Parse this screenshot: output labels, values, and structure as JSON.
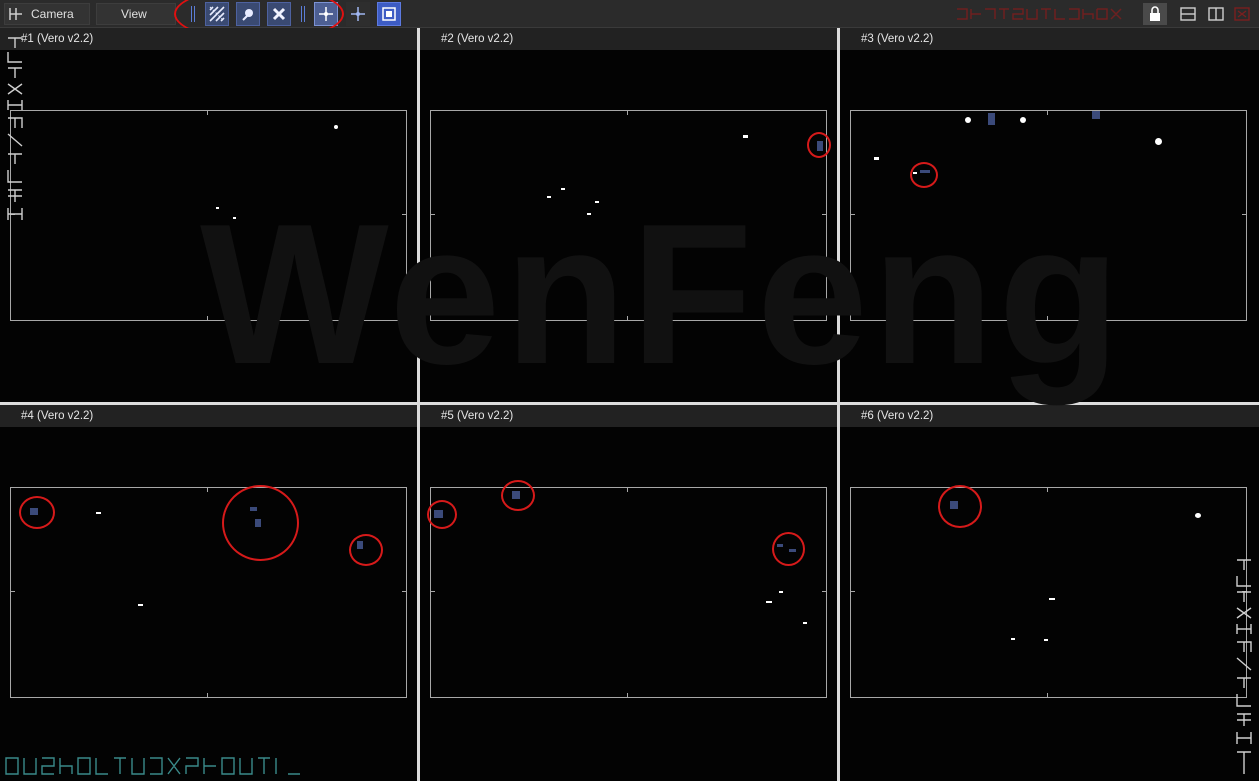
{
  "toolbar": {
    "camera_label": "Camera",
    "view_label": "View",
    "tools": [
      {
        "icon": "grid-pattern-icon"
      },
      {
        "icon": "marker-icon"
      },
      {
        "icon": "remove-markers-icon"
      },
      {
        "icon": "crosshair-add-icon"
      },
      {
        "icon": "crosshair-icon"
      },
      {
        "icon": "frame-icon"
      }
    ],
    "window_icons": [
      "lock-icon",
      "split-horizontal-icon",
      "split-vertical-icon",
      "close-icon"
    ]
  },
  "watermark": "WenFeng",
  "views": [
    {
      "title": "#1 (Vero v2.2)"
    },
    {
      "title": "#2 (Vero v2.2)"
    },
    {
      "title": "#3 (Vero v2.2)"
    },
    {
      "title": "#4 (Vero v2.2)"
    },
    {
      "title": "#5 (Vero v2.2)"
    },
    {
      "title": "#6 (Vero v2.2)"
    }
  ],
  "colors": {
    "accent": "#5b7dd8",
    "annotation": "#d61a1a",
    "blob": "#3b4a7a",
    "divider": "#dcdcdc"
  }
}
